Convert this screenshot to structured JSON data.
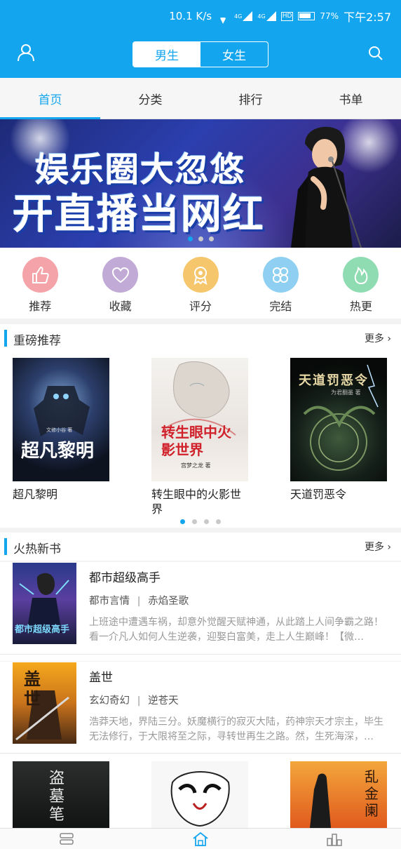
{
  "status_bar": {
    "speed": "10.1 K/s",
    "net1": "4G",
    "net2": "4G",
    "hd": "HD",
    "battery": "77%",
    "time": "下午2:57"
  },
  "header": {
    "gender_tabs": [
      {
        "label": "男生",
        "active": true
      },
      {
        "label": "女生",
        "active": false
      }
    ],
    "icons": {
      "left": "user-icon",
      "right": "search-icon"
    }
  },
  "tabs": [
    {
      "label": "首页",
      "active": true
    },
    {
      "label": "分类"
    },
    {
      "label": "排行"
    },
    {
      "label": "书单"
    }
  ],
  "banner": {
    "line1": "娱乐圈大忽悠",
    "line2": "开直播当网红",
    "pages": 3,
    "current": 1
  },
  "quick_menu": [
    {
      "label": "推荐",
      "icon": "thumbs-up-icon",
      "color": "#f4a3a8"
    },
    {
      "label": "收藏",
      "icon": "heart-icon",
      "color": "#c1aad6"
    },
    {
      "label": "评分",
      "icon": "medal-icon",
      "color": "#f5c66c"
    },
    {
      "label": "完结",
      "icon": "clover-icon",
      "color": "#8fd0f2"
    },
    {
      "label": "热更",
      "icon": "flame-icon",
      "color": "#90dcb2"
    }
  ],
  "featured": {
    "title": "重磅推荐",
    "more": "更多",
    "books": [
      {
        "name": "超凡黎明",
        "cover_title": "超凡黎明",
        "cover_author": "文修小谷 著"
      },
      {
        "name": "转生眼中的火影世界",
        "cover_title": "转生眼中火影世界",
        "cover_author": "宫梦之龙 著"
      },
      {
        "name": "天道罚恶令",
        "cover_title": "天道罚恶令",
        "cover_author": "为君翻墨 著"
      }
    ],
    "pages": 4,
    "current": 1
  },
  "new_books": {
    "title": "火热新书",
    "more": "更多",
    "items": [
      {
        "title": "都市超级高手",
        "genre": "都市言情",
        "author": "赤焰圣歌",
        "desc": "上班途中遭遇车祸，却意外觉醒天赋神通，从此踏上人间争霸之路！看一介凡人如何人生逆袭，迎娶白富美，走上人生巅峰！【微…",
        "cover_title": "都市超级高手"
      },
      {
        "title": "盖世",
        "genre": "玄幻奇幻",
        "author": "逆苍天",
        "desc": "浩莽天地，界陆三分。妖魔横行的寂灭大陆，药神宗天才宗主，毕生无法修行，于大限将至之际，寻转世再生之路。然，生死海深，…",
        "cover_title": "盖世"
      }
    ]
  },
  "bottom_covers": [
    {
      "title": "盗墓笔"
    },
    {
      "title": ""
    },
    {
      "title": "乱金阑"
    }
  ],
  "bottom_nav": [
    {
      "icon": "bookshelf-icon"
    },
    {
      "icon": "home-icon",
      "active": true
    },
    {
      "icon": "ranking-icon"
    }
  ],
  "colors": {
    "accent": "#13a6ee"
  }
}
